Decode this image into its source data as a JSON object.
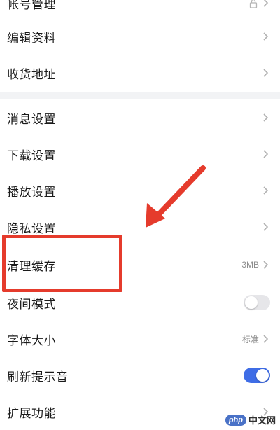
{
  "settings": {
    "account": {
      "label": "帐号管理"
    },
    "edit_profile": {
      "label": "编辑资料"
    },
    "address": {
      "label": "收货地址"
    },
    "notifications": {
      "label": "消息设置"
    },
    "download": {
      "label": "下载设置"
    },
    "playback": {
      "label": "播放设置"
    },
    "privacy": {
      "label": "隐私设置"
    },
    "clear_cache": {
      "label": "清理缓存",
      "value": "3MB"
    },
    "night_mode": {
      "label": "夜间模式",
      "enabled": false
    },
    "font_size": {
      "label": "字体大小",
      "value": "标准"
    },
    "refresh_sound": {
      "label": "刷新提示音",
      "enabled": true
    },
    "extensions": {
      "label": "扩展功能"
    }
  },
  "annotation": {
    "color": "#e53b2c"
  },
  "watermark": {
    "badge": "php",
    "text": "中文网"
  },
  "colors": {
    "toggle_on": "#3f6de6",
    "toggle_off": "#e6e6e9",
    "divider": "#f2f3f5"
  }
}
